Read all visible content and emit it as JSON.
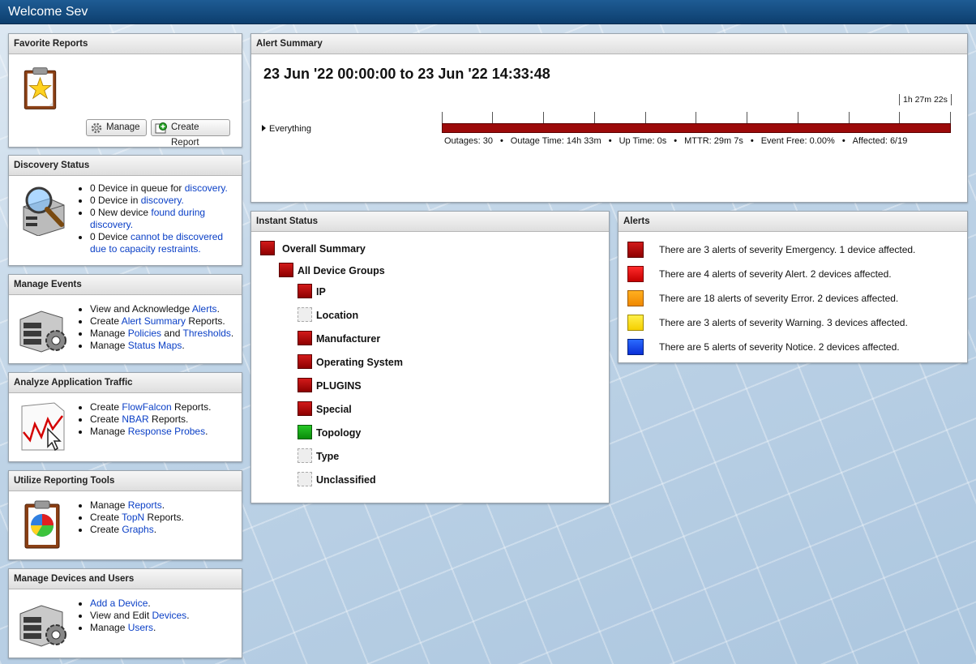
{
  "header": {
    "title": "Welcome Sev"
  },
  "favorite_reports": {
    "title": "Favorite Reports",
    "manage_label": "Manage",
    "create_label": "Create Report"
  },
  "discovery": {
    "title": "Discovery Status",
    "items": [
      {
        "text": "0 Device in queue for ",
        "link": "discovery."
      },
      {
        "text": "0 Device in ",
        "link": "discovery."
      },
      {
        "text": "0 New device ",
        "link": "found during discovery."
      },
      {
        "text": "0 Device ",
        "link": "cannot be discovered due to capacity restraints."
      }
    ]
  },
  "events": {
    "title": "Manage Events",
    "items": [
      {
        "text": "View and Acknowledge ",
        "link": "Alerts",
        "after": "."
      },
      {
        "text": "Create ",
        "link": "Alert Summary",
        "after": " Reports."
      },
      {
        "text": "Manage ",
        "link": "Policies",
        "mid": " and ",
        "link2": "Thresholds",
        "after": "."
      },
      {
        "text": "Manage ",
        "link": "Status Maps",
        "after": "."
      }
    ]
  },
  "traffic": {
    "title": "Analyze Application Traffic",
    "items": [
      {
        "text": "Create ",
        "link": "FlowFalcon",
        "after": " Reports."
      },
      {
        "text": "Create ",
        "link": "NBAR",
        "after": " Reports."
      },
      {
        "text": "Manage ",
        "link": "Response Probes",
        "after": "."
      }
    ]
  },
  "reporting": {
    "title": "Utilize Reporting Tools",
    "items": [
      {
        "text": "Manage ",
        "link": "Reports",
        "after": "."
      },
      {
        "text": "Create ",
        "link": "TopN",
        "after": " Reports."
      },
      {
        "text": "Create ",
        "link": "Graphs",
        "after": "."
      }
    ]
  },
  "devices": {
    "title": "Manage Devices and Users",
    "items": [
      {
        "text": "",
        "link": "Add a Device",
        "after": "."
      },
      {
        "text": "View and Edit ",
        "link": "Devices",
        "after": "."
      },
      {
        "text": "Manage ",
        "link": "Users",
        "after": "."
      }
    ]
  },
  "alert_summary": {
    "title": "Alert Summary",
    "range": "23 Jun '22 00:00:00 to 23 Jun '22 14:33:48",
    "scale_label": "1h 27m 22s",
    "group": "Everything",
    "stats": [
      "Outages: 30",
      "Outage Time: 14h 33m",
      "Up Time: 0s",
      "MTTR: 29m 7s",
      "Event Free: 0.00%",
      "Affected: 6/19"
    ]
  },
  "instant_status": {
    "title": "Instant Status",
    "overall": "Overall Summary",
    "all_groups": "All Device Groups",
    "groups": [
      {
        "label": "IP",
        "status": "red"
      },
      {
        "label": "Location",
        "status": "empty"
      },
      {
        "label": "Manufacturer",
        "status": "red"
      },
      {
        "label": "Operating System",
        "status": "red"
      },
      {
        "label": "PLUGINS",
        "status": "red"
      },
      {
        "label": "Special",
        "status": "red"
      },
      {
        "label": "Topology",
        "status": "green"
      },
      {
        "label": "Type",
        "status": "empty"
      },
      {
        "label": "Unclassified",
        "status": "empty"
      }
    ]
  },
  "alerts": {
    "title": "Alerts",
    "rows": [
      {
        "text": "There are 3 alerts of severity Emergency. 1 device affected.",
        "severity": "red",
        "color": "#a00000"
      },
      {
        "text": "There are 4 alerts of severity Alert. 2 devices affected.",
        "severity": "alert",
        "color": "#e00000"
      },
      {
        "text": "There are 18 alerts of severity Error. 2 devices affected.",
        "severity": "error",
        "color": "#f59a00"
      },
      {
        "text": "There are 3 alerts of severity Warning. 3 devices affected.",
        "severity": "warn",
        "color": "#ffe01a"
      },
      {
        "text": "There are 5 alerts of severity Notice. 2 devices affected.",
        "severity": "notice",
        "color": "#1a45f0"
      }
    ]
  }
}
